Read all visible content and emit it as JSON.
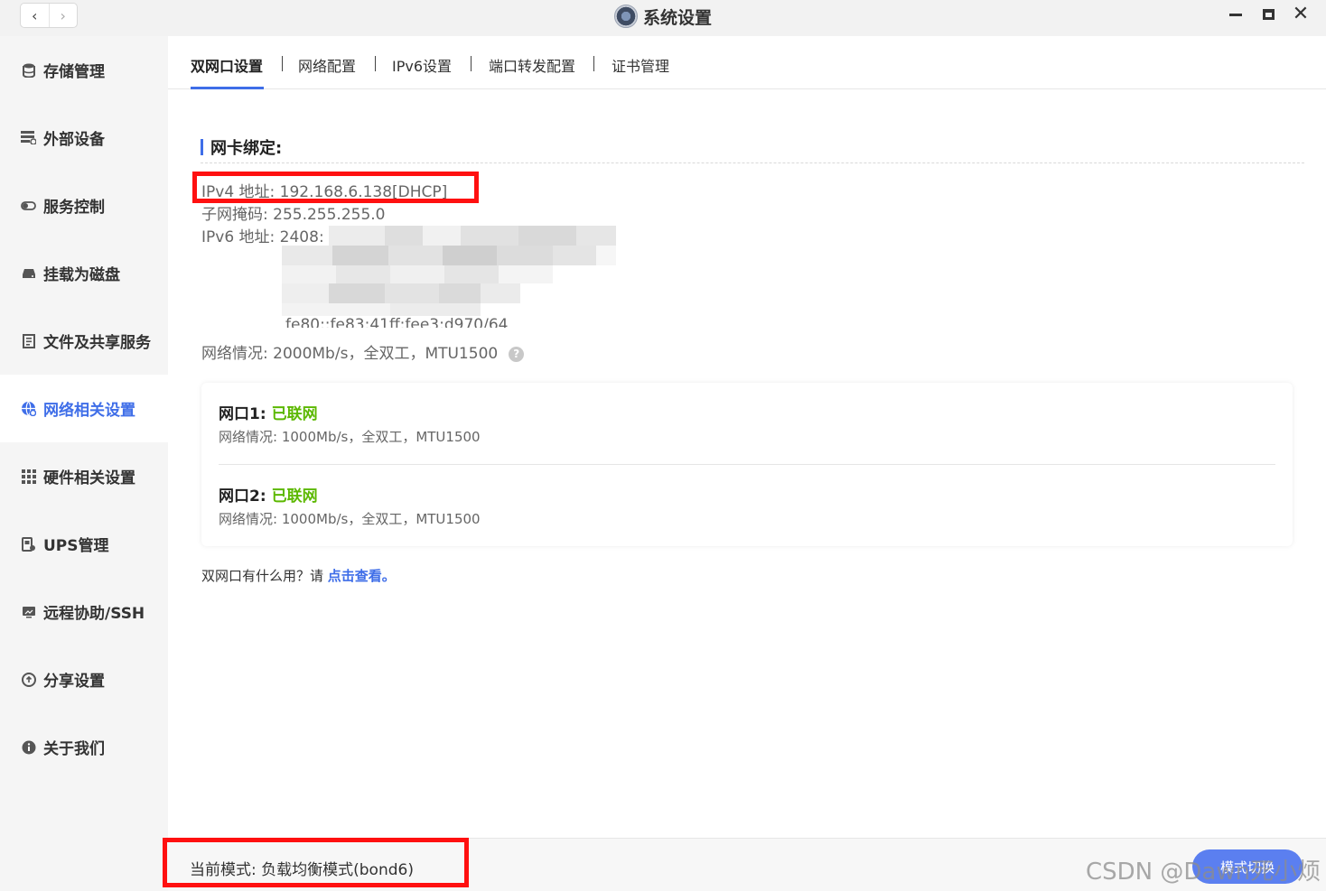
{
  "window": {
    "title": "系统设置",
    "back_glyph": "‹",
    "forward_glyph": "›",
    "close_glyph": "✕",
    "icons": [
      "app-logo-icon",
      "minimize-icon",
      "maximize-icon",
      "close-icon"
    ]
  },
  "sidebar": {
    "items": [
      {
        "label": "存储管理",
        "icon": "database-icon"
      },
      {
        "label": "外部设备",
        "icon": "external-device-icon"
      },
      {
        "label": "服务控制",
        "icon": "toggle-icon"
      },
      {
        "label": "挂载为磁盘",
        "icon": "disk-icon"
      },
      {
        "label": "文件及共享服务",
        "icon": "file-share-icon"
      },
      {
        "label": "网络相关设置",
        "icon": "globe-icon",
        "active": true
      },
      {
        "label": "硬件相关设置",
        "icon": "grid-icon"
      },
      {
        "label": "UPS管理",
        "icon": "ups-icon"
      },
      {
        "label": "远程协助/SSH",
        "icon": "remote-icon"
      },
      {
        "label": "分享设置",
        "icon": "share-icon"
      },
      {
        "label": "关于我们",
        "icon": "info-icon"
      }
    ]
  },
  "tabs": [
    {
      "label": "双网口设置",
      "active": true
    },
    {
      "label": "网络配置"
    },
    {
      "label": "IPv6设置"
    },
    {
      "label": "端口转发配置"
    },
    {
      "label": "证书管理"
    }
  ],
  "bond": {
    "title": "网卡绑定:",
    "ipv4": "IPv4 地址:  192.168.6.138[DHCP]",
    "subnet": "子网掩码:  255.255.255.0",
    "ipv6": "IPv6 地址:  2408:",
    "ipv6_tail": "fe80::fe83:41ff:fee3:d970/64",
    "network": "网络情况:  2000Mb/s，全双工，MTU1500",
    "help_glyph": "?"
  },
  "ports": [
    {
      "title": "网口1:",
      "status": "已联网",
      "info": "网络情况:   1000Mb/s，全双工，MTU1500"
    },
    {
      "title": "网口2:",
      "status": "已联网",
      "info": "网络情况:   1000Mb/s，全双工，MTU1500"
    }
  ],
  "help": {
    "text": "双网口有什么用？请 ",
    "link": "点击查看。"
  },
  "footer": {
    "mode": "当前模式:  负载均衡模式(bond6)",
    "button": "模式切换"
  },
  "watermark": "CSDN @Dawn死小烦",
  "colors": {
    "accent": "#3f6ee8",
    "online": "#5cb800",
    "annotation": "#ff1010"
  }
}
